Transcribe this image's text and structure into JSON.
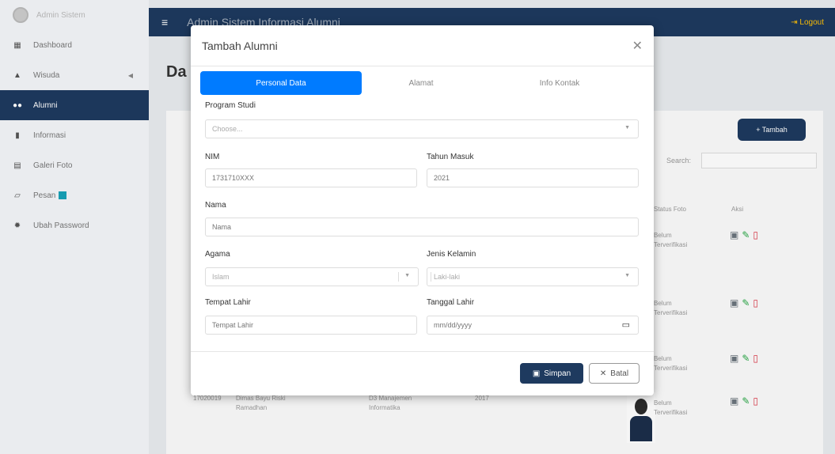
{
  "sidebar": {
    "brand": "Admin Sistem",
    "items": [
      {
        "label": "Dashboard",
        "icon": "grid-icon"
      },
      {
        "label": "Wisuda",
        "icon": "graduation-cap-icon"
      },
      {
        "label": "Alumni",
        "icon": "users-icon",
        "active": true
      },
      {
        "label": "Informasi",
        "icon": "file-icon"
      },
      {
        "label": "Galeri Foto",
        "icon": "image-icon"
      },
      {
        "label": "Pesan",
        "icon": "message-icon"
      },
      {
        "label": "Ubah Password",
        "icon": "gear-icon"
      }
    ]
  },
  "topbar": {
    "title": "Admin Sistem Informasi Alumni",
    "logout": "Logout"
  },
  "page": {
    "title": "Da",
    "tambah": "+ Tambah",
    "search_label": "Search:",
    "col_status": "Status Foto",
    "col_aksi": "Aksi",
    "status": [
      "Belum Terverifikasi",
      "Belum Terverifikasi",
      "Belum Terverifikasi",
      "Belum Terverifikasi"
    ],
    "row_nim": "17020019",
    "row_name": "Dimas Bayu Riski Ramadhan",
    "row_prodi": "D3 Manajemen Informatika",
    "row_year": "2017"
  },
  "modal": {
    "title": "Tambah Alumni",
    "tabs": [
      "Personal Data",
      "Alamat",
      "Info Kontak"
    ],
    "program_studi": {
      "label": "Program Studi",
      "value": "Choose..."
    },
    "nim": {
      "label": "NIM",
      "placeholder": "1731710XXX"
    },
    "tahun_masuk": {
      "label": "Tahun Masuk",
      "placeholder": "2021"
    },
    "nama": {
      "label": "Nama",
      "placeholder": "Nama"
    },
    "agama": {
      "label": "Agama",
      "value": "Islam"
    },
    "jenis_kelamin": {
      "label": "Jenis Kelamin",
      "value": "Laki-laki"
    },
    "tempat_lahir": {
      "label": "Tempat Lahir",
      "placeholder": "Tempat Lahir"
    },
    "tanggal_lahir": {
      "label": "Tanggal Lahir",
      "value": "mm/dd/yyyy"
    },
    "simpan": "Simpan",
    "batal": "Batal"
  }
}
